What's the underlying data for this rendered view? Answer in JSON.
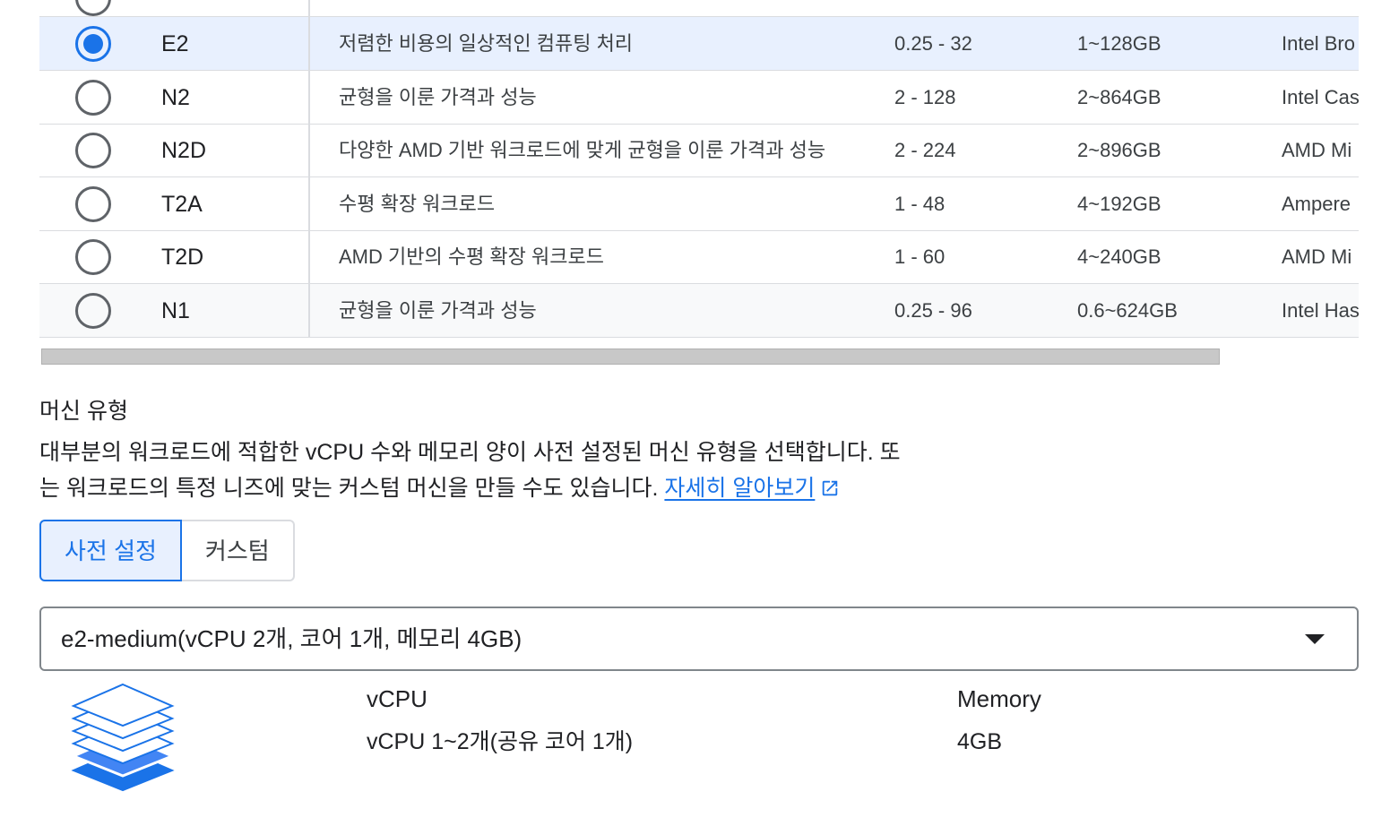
{
  "table": {
    "rows": [
      {
        "series": "E2",
        "description": "저렴한 비용의 일상적인 컴퓨팅 처리",
        "vcpu": "0.25 - 32",
        "memory": "1~128GB",
        "platform": "Intel Bro",
        "selected": true
      },
      {
        "series": "N2",
        "description": "균형을 이룬 가격과 성능",
        "vcpu": "2 - 128",
        "memory": "2~864GB",
        "platform": "Intel Cas",
        "selected": false
      },
      {
        "series": "N2D",
        "description": "다양한 AMD 기반 워크로드에 맞게 균형을 이룬 가격과 성능",
        "vcpu": "2 - 224",
        "memory": "2~896GB",
        "platform": "AMD Mi",
        "selected": false
      },
      {
        "series": "T2A",
        "description": "수평 확장 워크로드",
        "vcpu": "1 - 48",
        "memory": "4~192GB",
        "platform": "Ampere",
        "selected": false
      },
      {
        "series": "T2D",
        "description": "AMD 기반의 수평 확장 워크로드",
        "vcpu": "1 - 60",
        "memory": "4~240GB",
        "platform": "AMD Mi",
        "selected": false
      },
      {
        "series": "N1",
        "description": "균형을 이룬 가격과 성능",
        "vcpu": "0.25 - 96",
        "memory": "0.6~624GB",
        "platform": "Intel Has",
        "selected": false
      }
    ]
  },
  "machine_type": {
    "title": "머신 유형",
    "description_line1": "대부분의 워크로드에 적합한 vCPU 수와 메모리 양이 사전 설정된 머신 유형을 선택합니다. 또",
    "description_line2": "는 워크로드의 특정 니즈에 맞는 커스텀 머신을 만들 수도 있습니다. ",
    "learn_more": "자세히 알아보기",
    "tabs": {
      "preset": "사전 설정",
      "custom": "커스텀"
    },
    "selected_value": "e2-medium(vCPU 2개, 코어 1개, 메모리 4GB)"
  },
  "specs": {
    "vcpu_label": "vCPU",
    "vcpu_value": "vCPU 1~2개(공유 코어 1개)",
    "memory_label": "Memory",
    "memory_value": "4GB"
  },
  "colors": {
    "accent": "#1a73e8",
    "selected_row": "#e8f0fe",
    "border": "#dadce0"
  },
  "icons": {
    "link": "external-link-icon",
    "dropdown": "chevron-down-icon",
    "machine": "layers-chip-icon"
  }
}
